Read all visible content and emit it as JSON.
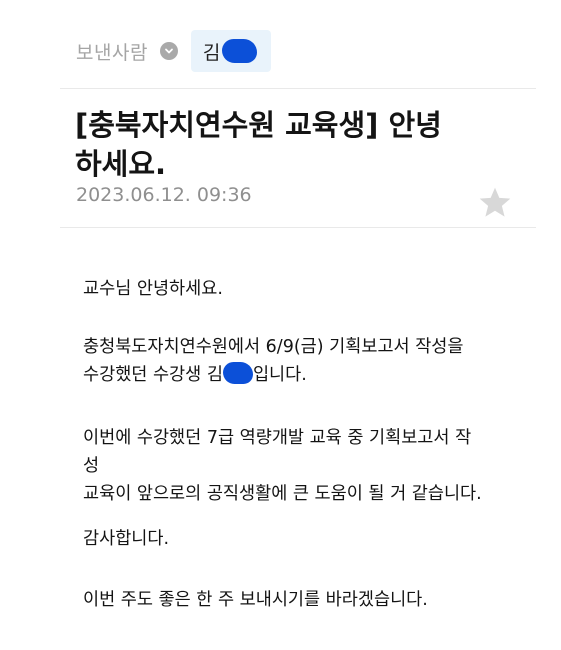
{
  "header": {
    "sender_label": "보낸사람",
    "sender_name": "김"
  },
  "subject": "[충북자치연수원 교육생] 안녕하세요.",
  "date": "2023.06.12. 09:36",
  "icons": {
    "sender_toggle": "chevron-down-icon",
    "favorite": "star-icon"
  },
  "colors": {
    "chip_background": "#e9f3fb",
    "redaction": "#0c50d8",
    "star": "#d8d8d8"
  },
  "body": {
    "greeting": "교수님 안녕하세요.",
    "para1_line1": "충청북도자치연수원에서 6/9(금) 기획보고서 작성을",
    "para1_line2_prefix": "수강했던 수강생 김",
    "para1_line2_suffix": "입니다.",
    "para2_line1": "이번에 수강했던 7급 역량개발 교육 중 기획보고서 작",
    "para2_line2": "성",
    "para2_line3": "교육이 앞으로의 공직생활에 큰 도움이 될 거 같습니다.",
    "thanks": "감사합니다.",
    "closing": "이번 주도 좋은 한 주 보내시기를 바라겠습니다."
  }
}
